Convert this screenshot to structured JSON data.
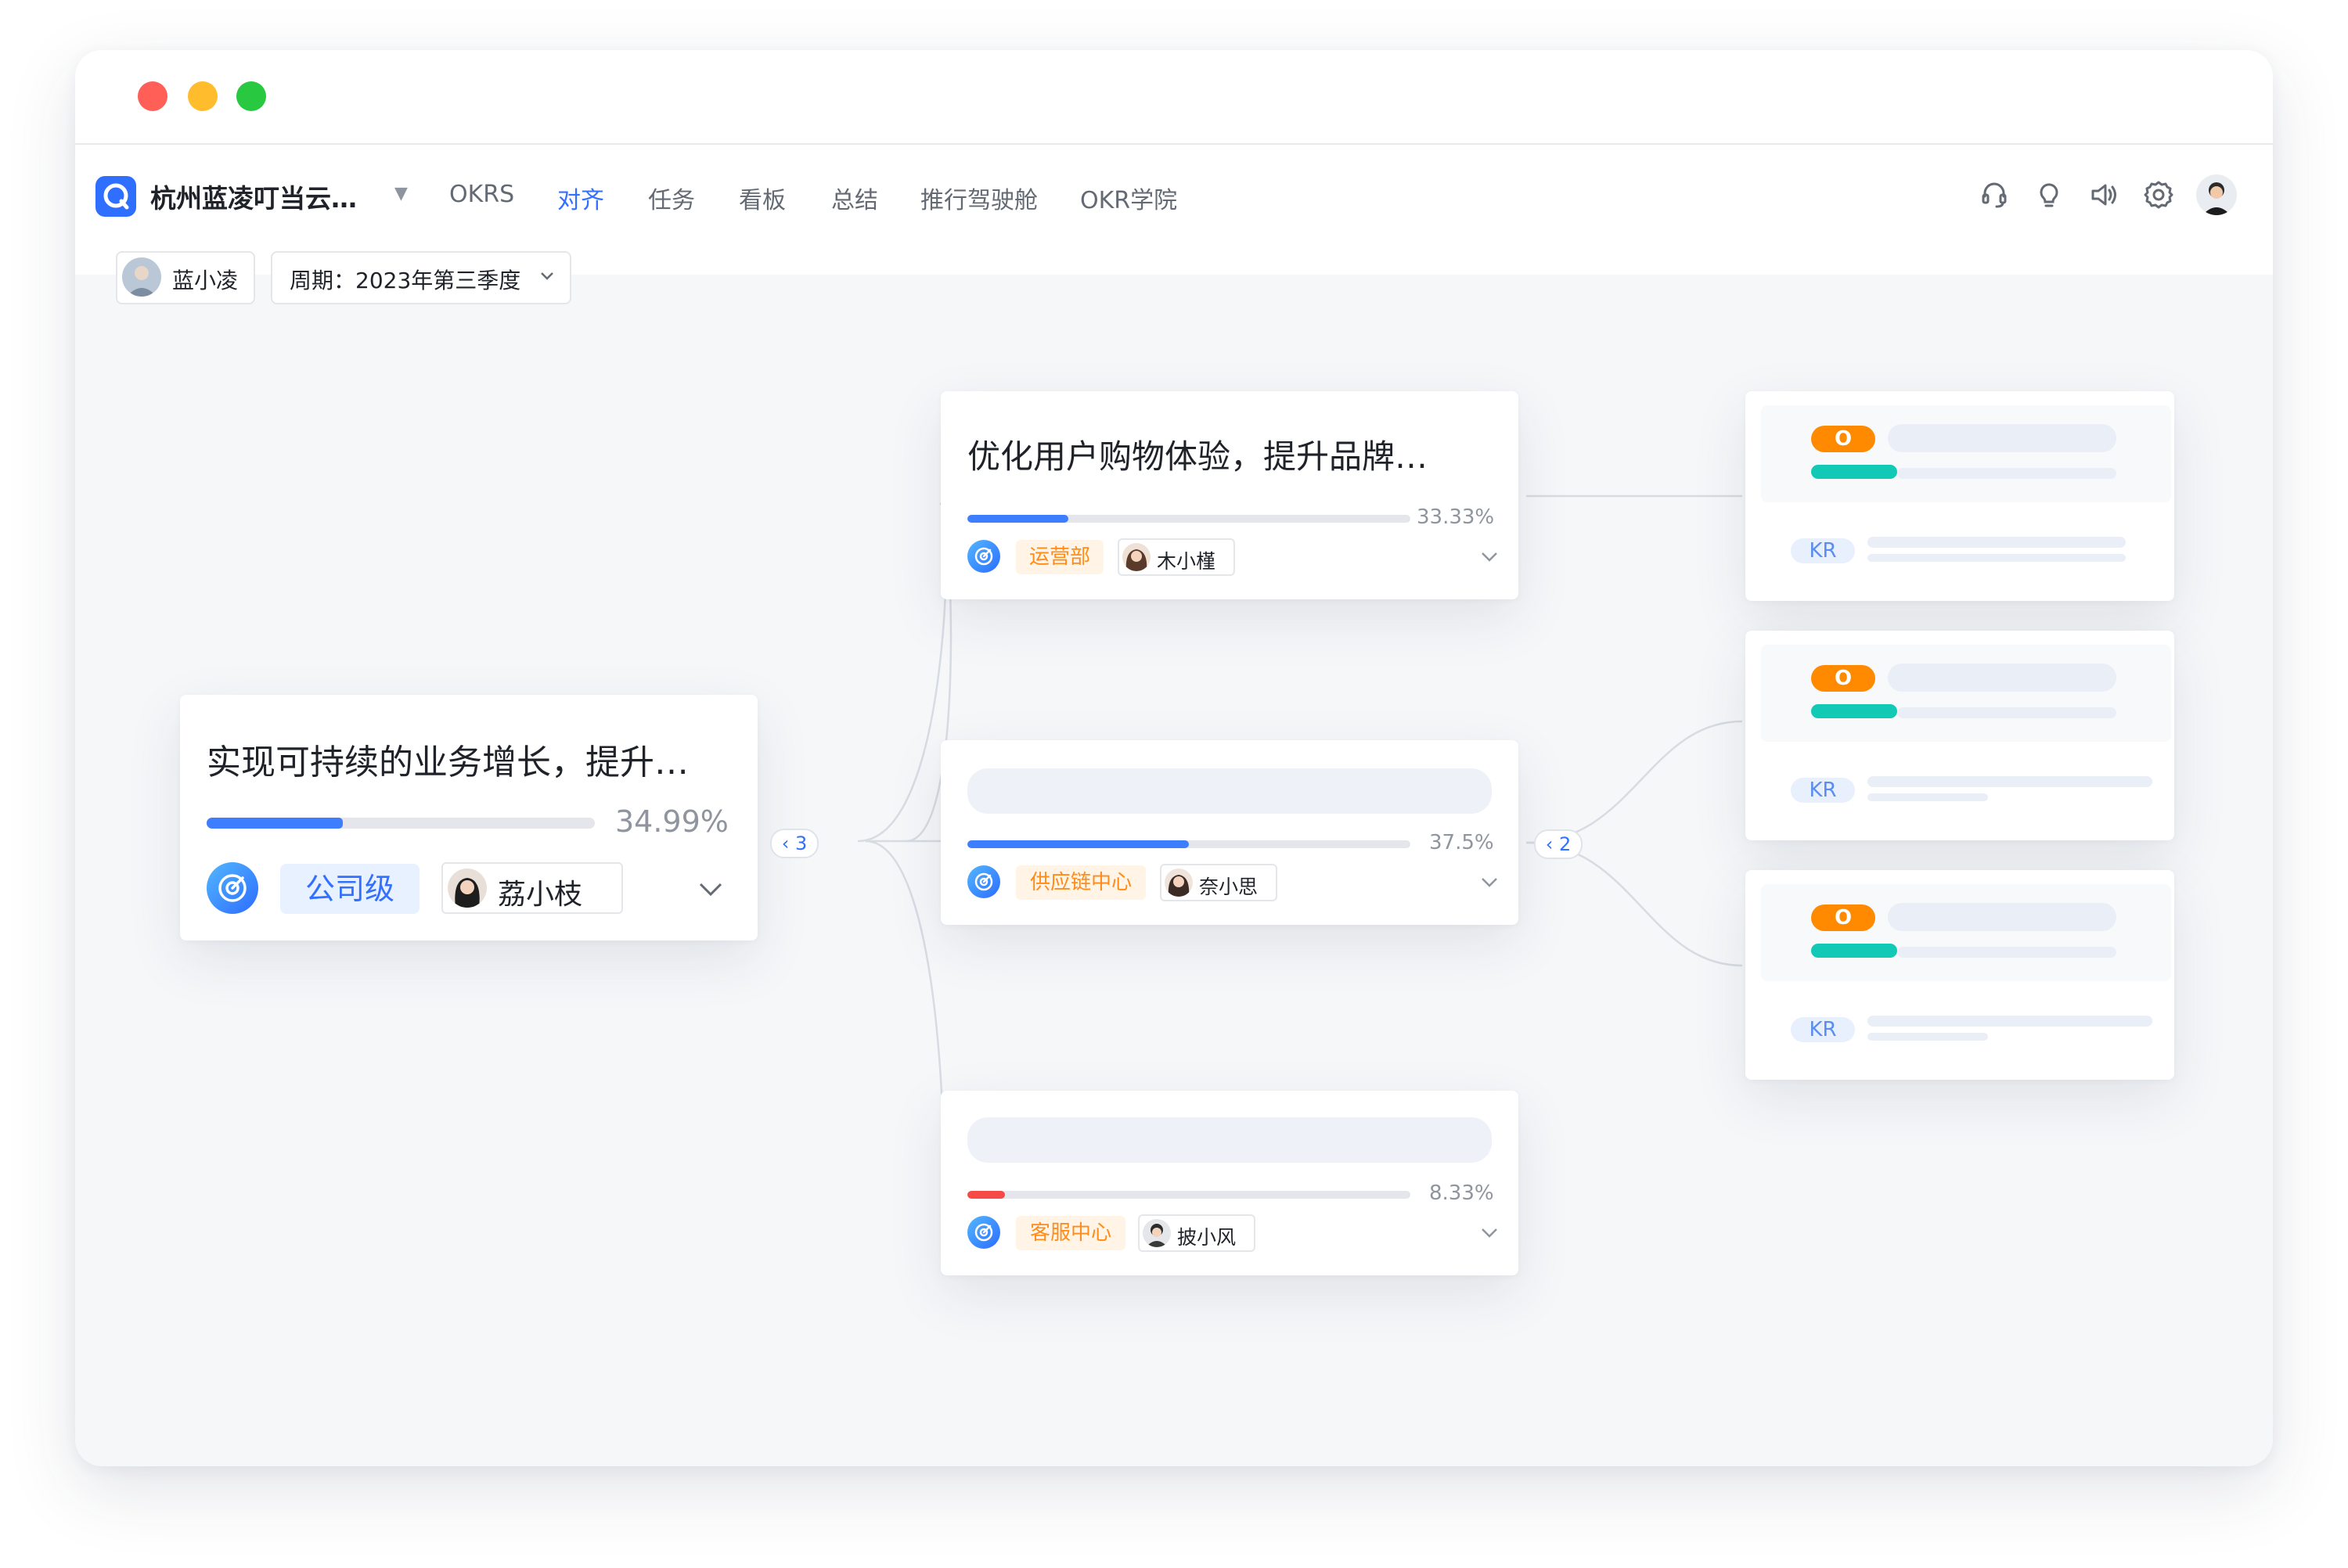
{
  "window": {
    "traffic_lights": {
      "close": "#ff5f57",
      "minimize": "#ffbd2e",
      "zoom": "#28c840"
    }
  },
  "navbar": {
    "company": "杭州蓝凌叮当云…",
    "items": [
      "OKRS",
      "对齐",
      "任务",
      "看板",
      "总结",
      "推行驾驶舱",
      "OKR学院"
    ],
    "active_item": "对齐",
    "icons": [
      "headset-icon",
      "lightbulb-icon",
      "speaker-icon",
      "settings-icon",
      "user-avatar"
    ],
    "accent": "#3370ff"
  },
  "toolbar": {
    "user": "蓝小凌",
    "period_label": "周期：2023年第三季度"
  },
  "root_objective": {
    "title": "实现可持续的业务增长，提升…",
    "progress_pct": 34.99,
    "progress_label": "34.99%",
    "level": "公司级",
    "owner": "荔小枝",
    "children_count_label": "3"
  },
  "child_objectives": [
    {
      "title": "优化用户购物体验，提升品牌…",
      "progress_pct": 33.33,
      "progress_label": "33.33%",
      "dept": "运营部",
      "owner": "木小槿",
      "bar_color": "#3d7eff"
    },
    {
      "title": "",
      "progress_pct": 37.5,
      "progress_label": "37.5%",
      "dept": "供应链中心",
      "owner": "奈小思",
      "bar_color": "#3d7eff",
      "children_count_label": "2"
    },
    {
      "title": "",
      "progress_pct": 8.33,
      "progress_label": "8.33%",
      "dept": "客服中心",
      "owner": "披小风",
      "bar_color": "#f54a45"
    }
  ],
  "okr_preview_cards": [
    {
      "o_label": "O",
      "kr_label": "KR"
    },
    {
      "o_label": "O",
      "kr_label": "KR"
    },
    {
      "o_label": "O",
      "kr_label": "KR"
    }
  ],
  "colors": {
    "primary": "#3370ff",
    "dept_tag_bg": "#fff4e6",
    "dept_tag_text": "#ff8c1a",
    "o_tag": "#ff8a00",
    "teal_progress": "#12c9b6"
  }
}
